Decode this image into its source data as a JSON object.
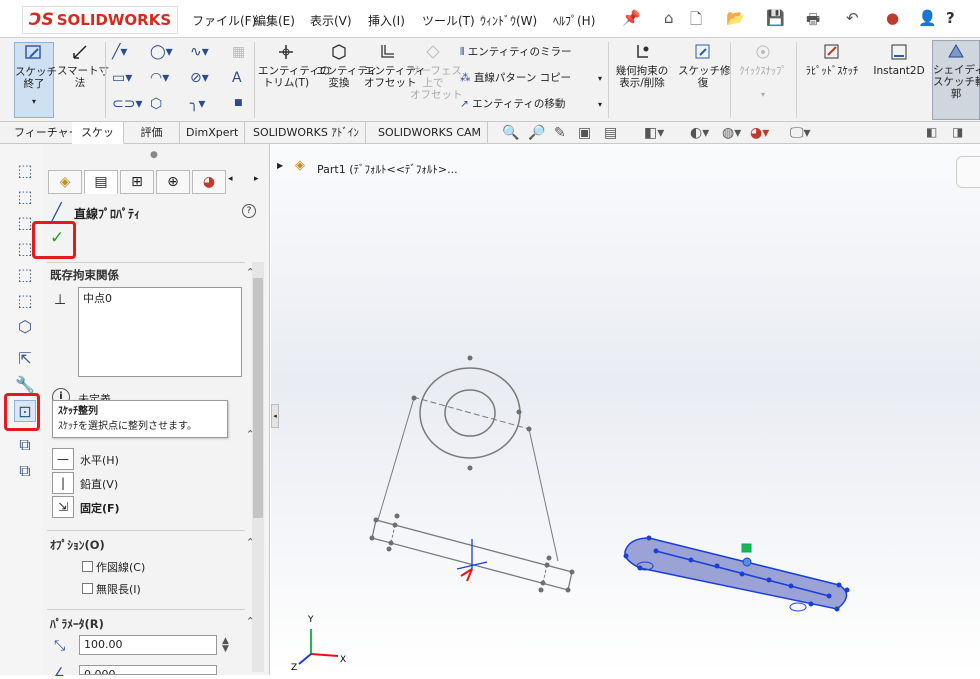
{
  "menubar": {
    "logo_ds": "ƆS",
    "logo_text": "SOLIDWORKS",
    "items": [
      "ファイル(F)",
      "編集(E)",
      "表示(V)",
      "挿入(I)",
      "ツール(T)",
      "ｳｨﾝﾄﾞｳ(W)",
      "ﾍﾙﾌﾟ(H)"
    ],
    "help_label": "?"
  },
  "commandbar": {
    "sketch_exit": "スケッチ\n終了",
    "smart_dim": "スマート寸\n法",
    "trim": "エンティティの\nトリム(T)",
    "convert": "エンティティ\n変換",
    "offset": "エンティティ\nオフセット",
    "surface_offset": "サーフェス\n上で\nオフセット",
    "mirror": "エンティティのミラー",
    "linear_pattern": "直線パターン コピー",
    "move": "エンティティの移動",
    "relations": "幾何拘束の\n表示/削除",
    "repair": "スケッチ修\n復",
    "quick_snap": "ｸｲｯｸｽﾅｯﾌﾟ",
    "rapid": "ﾗﾋﾟｯﾄﾞｽｹｯﾁ",
    "instant2d": "Instant2D",
    "shaded": "シェイディング\nスケッチ輪\n郭"
  },
  "tabs": [
    "フィーチャー",
    "スケッチ",
    "評価",
    "DimXpert",
    "SOLIDWORKS ｱﾄﾞｲﾝ",
    "SOLIDWORKS CAM"
  ],
  "tree": {
    "root": "Part1  (ﾃﾞﾌｫﾙﾄ<<ﾃﾞﾌｫﾙﾄ>..."
  },
  "panel": {
    "title": "直線ﾌﾟﾛﾊﾟﾃｨ",
    "ok_symbol": "✓",
    "help_symbol": "?",
    "existing_relations": "既存拘束関係",
    "relations_list": [
      "中点0"
    ],
    "status": "未定義",
    "add_relations": {
      "horizontal": "水平(H)",
      "vertical": "鉛直(V)",
      "fix": "固定(F)"
    },
    "options_title": "ｵﾌﾟｼｮﾝ(O)",
    "options": [
      {
        "label": "作図線(C)",
        "checked": false
      },
      {
        "label": "無限長(I)",
        "checked": false
      }
    ],
    "params_title": "ﾊﾟﾗﾒｰﾀ(R)",
    "length_value": "100.00",
    "angle_value": "0.000"
  },
  "tooltip": {
    "title": "ｽｹｯﾁ整列",
    "desc": "ｽｹｯﾁを選択点に整列させます。"
  },
  "axes": {
    "x": "X",
    "y": "Y",
    "z": "Z"
  },
  "colors": {
    "highlight_red": "#e31b1b",
    "selection_blue": "#1a3fd8",
    "sketch_gray": "#7a7a7a"
  }
}
